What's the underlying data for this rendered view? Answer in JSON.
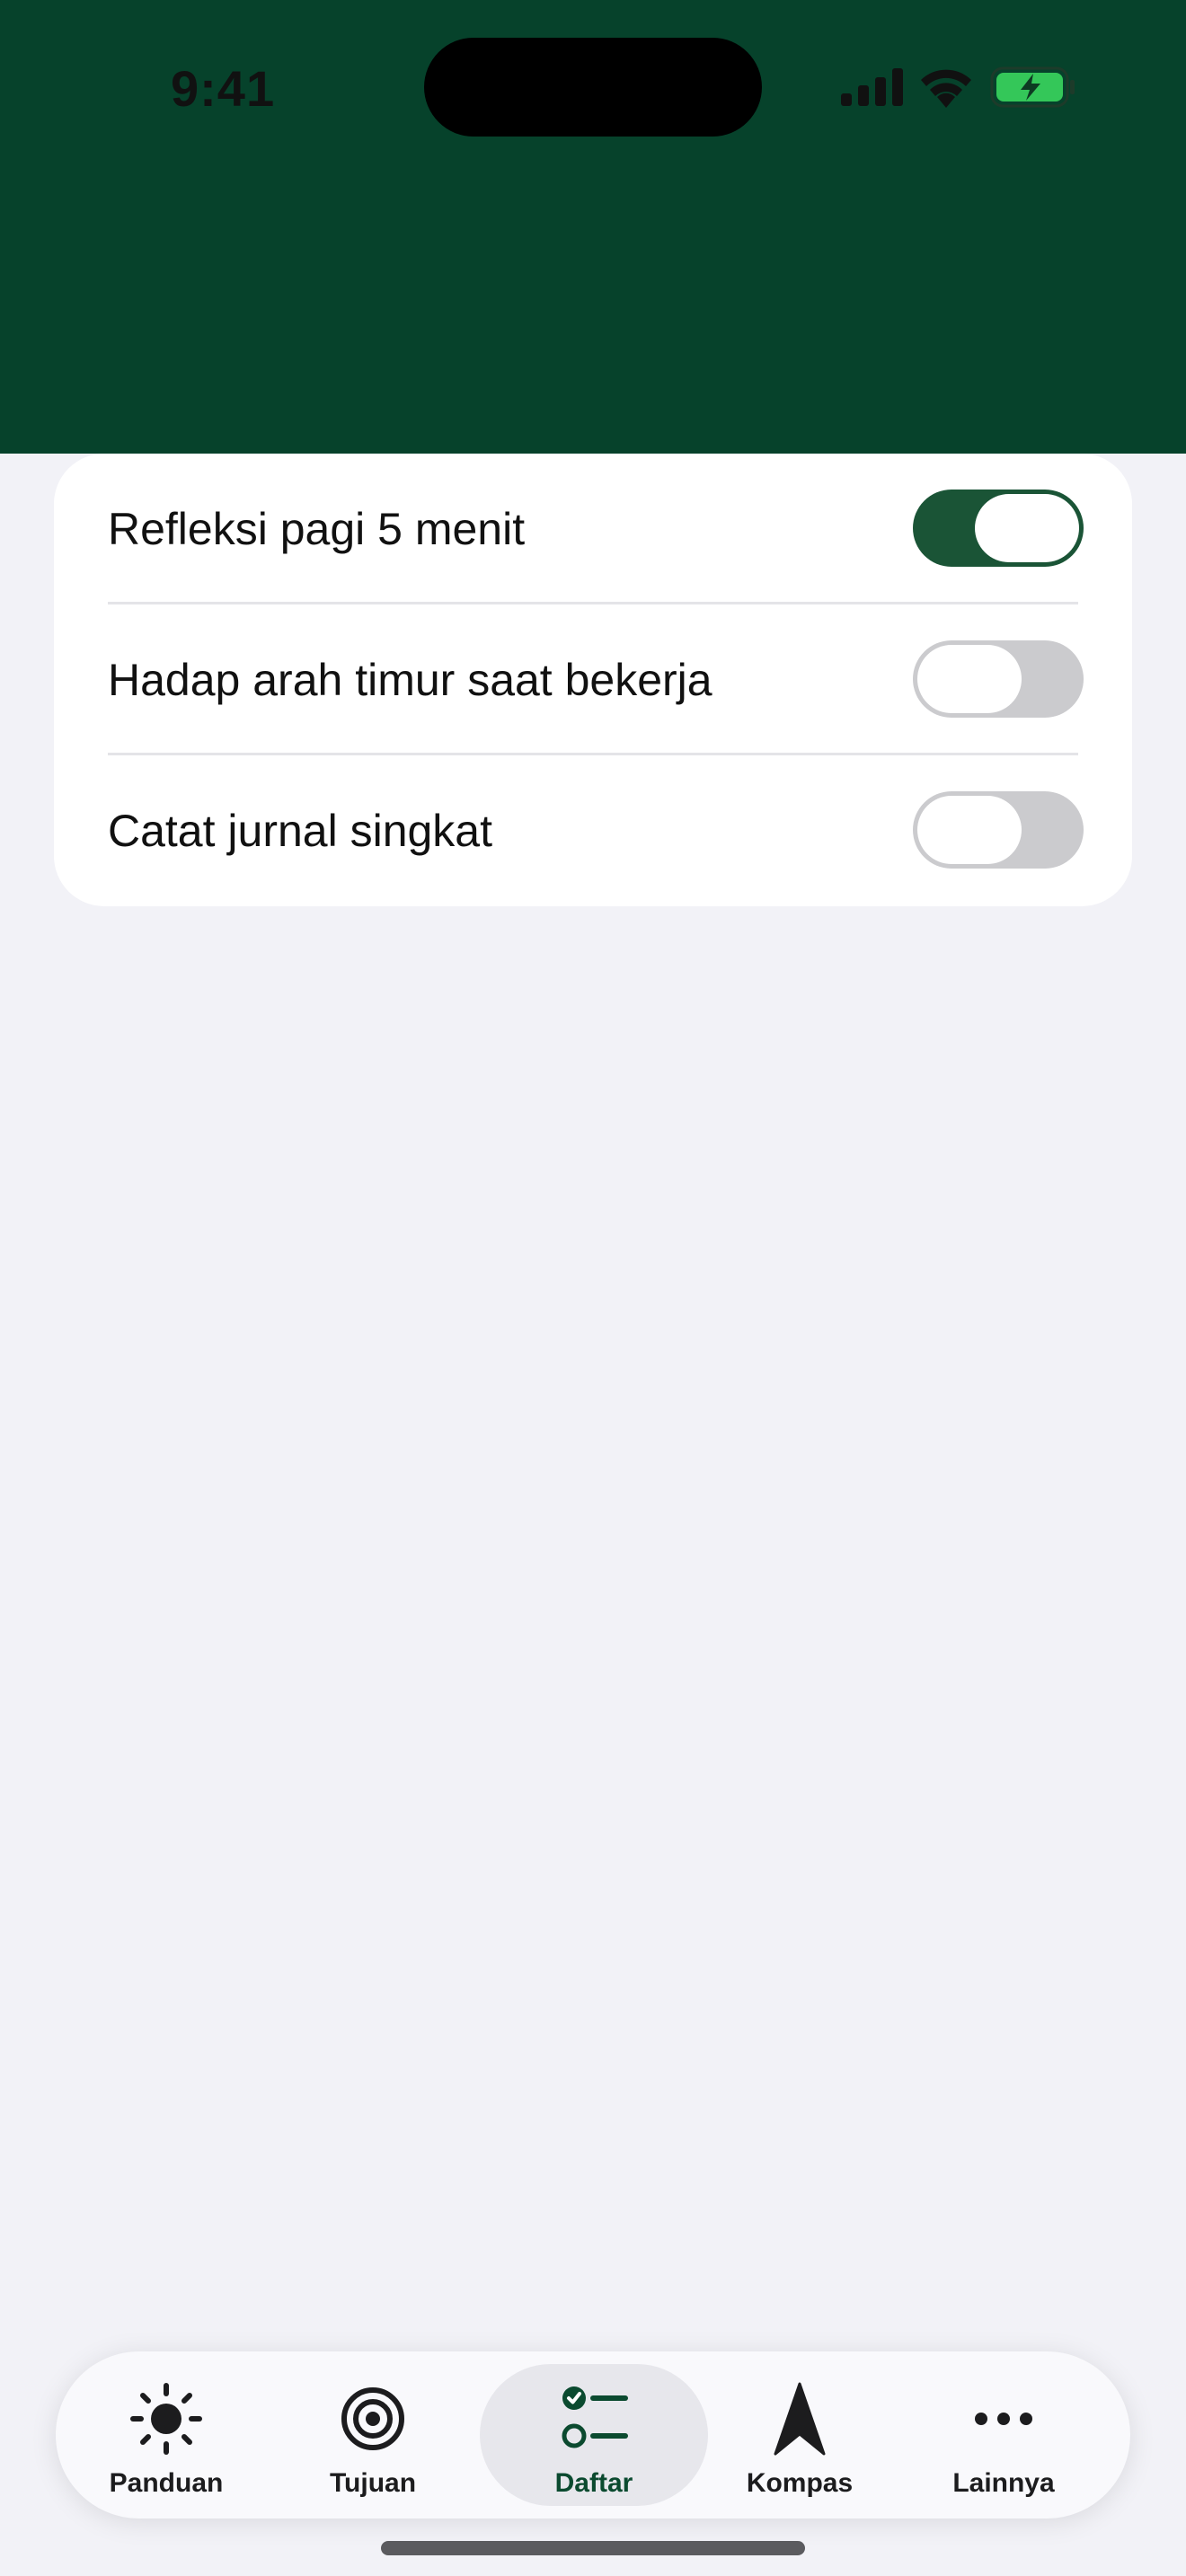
{
  "status_bar": {
    "time": "9:41"
  },
  "colors": {
    "header_bg": "#06422b",
    "accent": "#1a5436",
    "page_bg": "#f2f2f7",
    "toggle_off": "#cbcbce",
    "battery_green": "#34c759"
  },
  "settings": {
    "items": [
      {
        "label": "Refleksi pagi 5 menit",
        "enabled": true
      },
      {
        "label": "Hadap arah timur saat bekerja",
        "enabled": false
      },
      {
        "label": "Catat jurnal singkat",
        "enabled": false
      }
    ]
  },
  "tabbar": {
    "tabs": [
      {
        "label": "Panduan",
        "icon": "sun-icon",
        "active": false
      },
      {
        "label": "Tujuan",
        "icon": "target-icon",
        "active": false
      },
      {
        "label": "Daftar",
        "icon": "checklist-icon",
        "active": true
      },
      {
        "label": "Kompas",
        "icon": "compass-arrow-icon",
        "active": false
      },
      {
        "label": "Lainnya",
        "icon": "more-icon",
        "active": false
      }
    ]
  }
}
